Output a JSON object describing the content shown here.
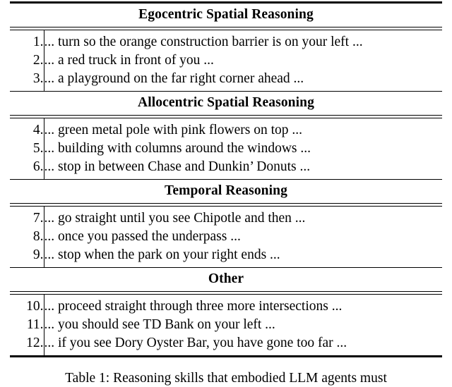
{
  "table": {
    "sections": [
      {
        "title": "Egocentric Spatial Reasoning",
        "rows": [
          {
            "num": "1.",
            "text": "... turn so the orange construction barrier is on your left ..."
          },
          {
            "num": "2.",
            "text": "... a red truck in front of you ..."
          },
          {
            "num": "3.",
            "text": "... a playground on the far right corner ahead ..."
          }
        ]
      },
      {
        "title": "Allocentric Spatial Reasoning",
        "rows": [
          {
            "num": "4.",
            "text": "... green metal pole with pink flowers on top ..."
          },
          {
            "num": "5.",
            "text": "... building with columns around the windows ..."
          },
          {
            "num": "6.",
            "text": "... stop in between Chase and Dunkin’ Donuts ..."
          }
        ]
      },
      {
        "title": "Temporal Reasoning",
        "rows": [
          {
            "num": "7.",
            "text": "... go straight until you see Chipotle and then ..."
          },
          {
            "num": "8.",
            "text": "... once you passed the underpass ..."
          },
          {
            "num": "9.",
            "text": "... stop when the park on your right ends ..."
          }
        ]
      },
      {
        "title": "Other",
        "rows": [
          {
            "num": "10.",
            "text": "... proceed straight through three more intersections ..."
          },
          {
            "num": "11.",
            "text": "... you should see TD Bank on your left ..."
          },
          {
            "num": "12.",
            "text": "... if you see Dory Oyster Bar, you have gone too far ..."
          }
        ]
      }
    ]
  },
  "caption": {
    "text": "Table 1:  Reasoning skills that embodied LLM agents must"
  }
}
